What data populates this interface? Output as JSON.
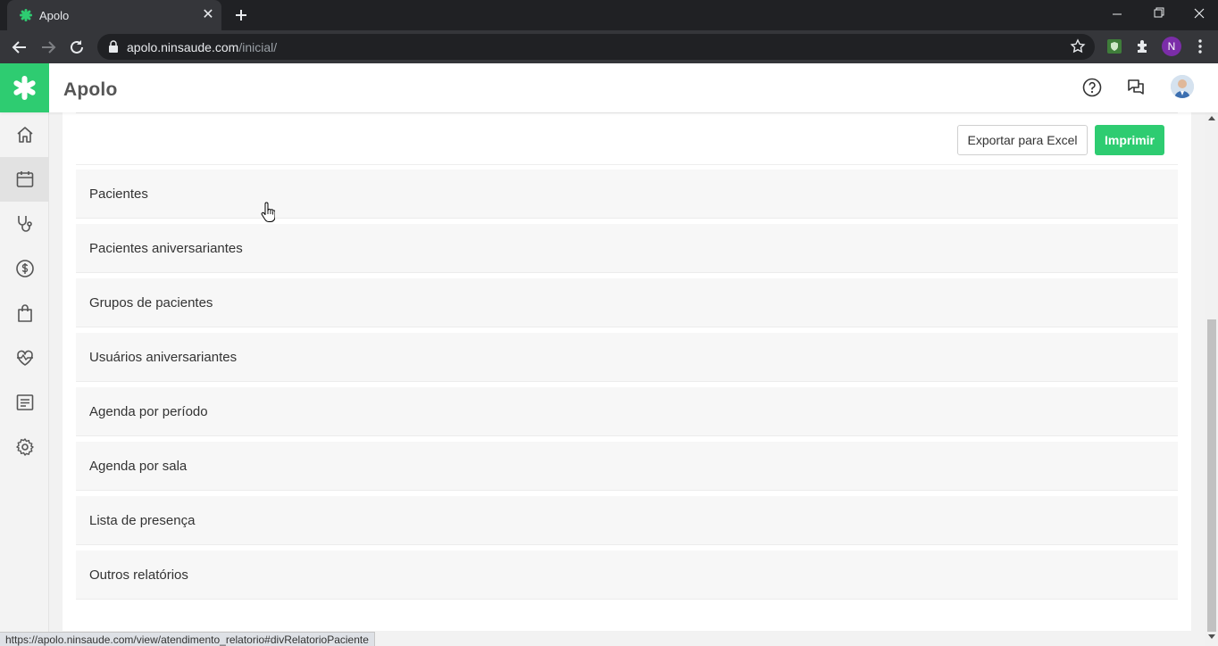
{
  "browser": {
    "tab_title": "Apolo",
    "url_host": "apolo.ninsaude.com",
    "url_path": "/inicial/",
    "profile_initial": "N",
    "status_url": "https://apolo.ninsaude.com/view/atendimento_relatorio#divRelatorioPaciente"
  },
  "app": {
    "title": "Apolo",
    "brand_color": "#2ecc71"
  },
  "sidebar": {
    "items": [
      {
        "icon": "home-icon"
      },
      {
        "icon": "calendar-icon",
        "active": true
      },
      {
        "icon": "stethoscope-icon"
      },
      {
        "icon": "dollar-icon"
      },
      {
        "icon": "shopping-bag-icon"
      },
      {
        "icon": "heart-pulse-icon"
      },
      {
        "icon": "list-icon"
      },
      {
        "icon": "gear-icon"
      }
    ]
  },
  "actions": {
    "export_label": "Exportar para Excel",
    "print_label": "Imprimir"
  },
  "reports": [
    {
      "label": "Pacientes"
    },
    {
      "label": "Pacientes aniversariantes"
    },
    {
      "label": "Grupos de pacientes"
    },
    {
      "label": "Usuários aniversariantes"
    },
    {
      "label": "Agenda por período"
    },
    {
      "label": "Agenda por sala"
    },
    {
      "label": "Lista de presença"
    },
    {
      "label": "Outros relatórios"
    }
  ]
}
